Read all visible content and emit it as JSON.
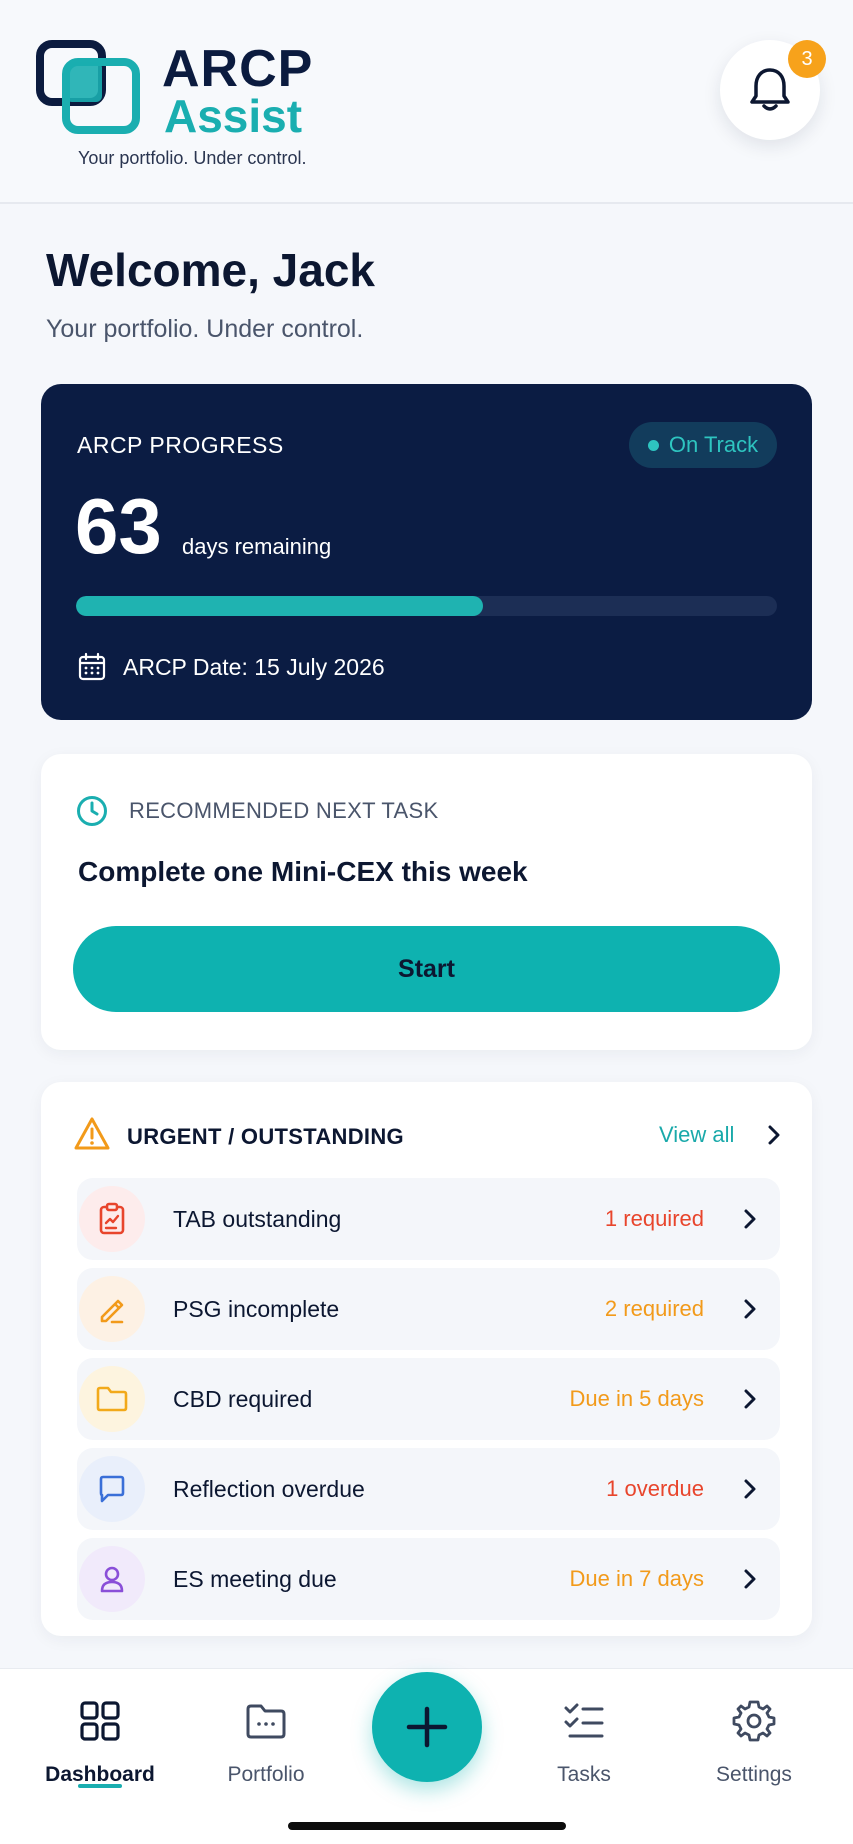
{
  "brand": {
    "name_line1": "ARCP",
    "name_line2": "Assist",
    "tagline": "Your portfolio. Under control.",
    "colors": {
      "navy": "#0b1c43",
      "teal": "#1aaeb0",
      "orange": "#f7a21b",
      "red": "#e8452c"
    }
  },
  "header": {
    "notification_icon": "bell-icon",
    "notification_count": "3"
  },
  "welcome": {
    "title": "Welcome, Jack",
    "subtitle": "Your portfolio. Under control."
  },
  "progress": {
    "label": "ARCP PROGRESS",
    "status": "On Track",
    "days": "63",
    "days_label": "days remaining",
    "progress_fraction": 0.58,
    "date_icon": "calendar-icon",
    "date_text": "ARCP Date: 15 July 2026"
  },
  "recommended": {
    "icon": "clock-icon",
    "label": "RECOMMENDED NEXT TASK",
    "title": "Complete one Mini-CEX this week",
    "button_label": "Start"
  },
  "urgent": {
    "icon": "warning-icon",
    "label": "URGENT / OUTSTANDING",
    "view_all": "View all",
    "items": [
      {
        "label": "TAB outstanding",
        "status": "1 required",
        "status_color": "#e8452c",
        "icon": "clipboard-icon",
        "icon_bg": "#fdecec",
        "icon_color": "#e8452c"
      },
      {
        "label": "PSG incomplete",
        "status": "2 required",
        "status_color": "#f29a1a",
        "icon": "pencil-icon",
        "icon_bg": "#fdf1e4",
        "icon_color": "#f29a1a"
      },
      {
        "label": "CBD required",
        "status": "Due in 5 days",
        "status_color": "#f29a1a",
        "icon": "folder-icon",
        "icon_bg": "#fdf4df",
        "icon_color": "#f2a91a"
      },
      {
        "label": "Reflection overdue",
        "status": "1 overdue",
        "status_color": "#e8452c",
        "icon": "chat-icon",
        "icon_bg": "#e9effb",
        "icon_color": "#3a6fd8"
      },
      {
        "label": "ES meeting due",
        "status": "Due in 7 days",
        "status_color": "#f29a1a",
        "icon": "user-icon",
        "icon_bg": "#f1eafb",
        "icon_color": "#8a4fd8"
      }
    ]
  },
  "nav": {
    "items": [
      {
        "label": "Dashboard",
        "icon": "grid-icon",
        "active": true
      },
      {
        "label": "Portfolio",
        "icon": "folder-icon",
        "active": false
      },
      {
        "label": "Tasks",
        "icon": "checklist-icon",
        "active": false
      },
      {
        "label": "Settings",
        "icon": "gear-icon",
        "active": false
      }
    ],
    "add_icon": "plus-icon"
  }
}
